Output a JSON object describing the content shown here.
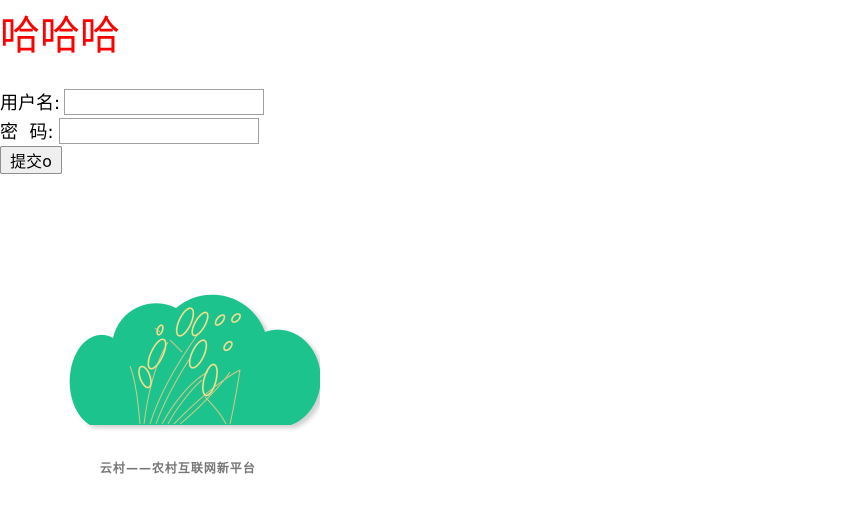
{
  "header": {
    "title": "哈哈哈"
  },
  "form": {
    "username_label": "用户名:",
    "password_label": "密  码:",
    "username_value": "",
    "password_value": "",
    "submit_label": "提交o"
  },
  "logo": {
    "slogan": "云村——农村互联网新平台"
  },
  "colors": {
    "heading": "#ff0000",
    "cloud": "#1dc38c",
    "wheat": "#f3df8c",
    "slogan": "#777777"
  }
}
